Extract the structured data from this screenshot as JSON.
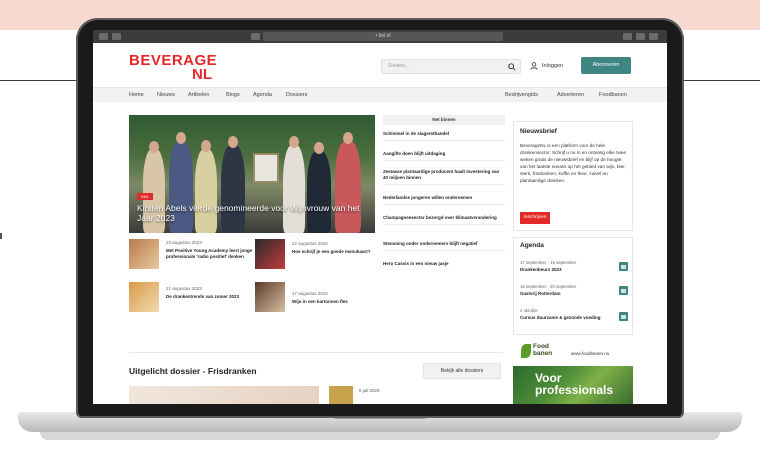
{
  "browser": {
    "url": "• bnl.nl"
  },
  "header": {
    "logo_top": "BEVERAGE",
    "logo_bottom": "NL",
    "search_placeholder": "Zoeken...",
    "login_label": "Inloggen",
    "subscribe_label": "Abonneren"
  },
  "nav": {
    "left": [
      "Home",
      "Nieuws",
      "Artikelen",
      "Blogs",
      "Agenda",
      "Dossiers"
    ],
    "right": [
      "Bedrijvengids",
      "Adverteren",
      "Foodbanen"
    ]
  },
  "hero": {
    "tag": "BNL",
    "title": "Kirsten Abels vierde genomineerde voor Wijnvrouw van het Jaar 2023"
  },
  "latest": {
    "tab_label": "Net binnen",
    "items": [
      "Schimmel in de slagersthandel",
      "Aangifte doen blijft uitdaging",
      "Zeeuwse plantaardige producent haalt investering van 40 miljoen binnen",
      "Nederlandse jongeren willen ondernemen",
      "Champagneesector bezorgd over klimaatverandering",
      "Stemming onder ondernemers blijft negatief",
      "Hero Cassis in een nieuw jasje"
    ]
  },
  "articles": [
    {
      "date": "23 augustus 2023",
      "title": "Met Positive Young Academy leert jonge professionals 'radio positief' denken"
    },
    {
      "date": "22 augustus 2023",
      "title": "Hoe schrijf je een goede menukaart?"
    },
    {
      "date": "21 augustus 2023",
      "title": "De drankentrends van zomer 2023"
    },
    {
      "date": "17 augustus 2023",
      "title": "Wijn in een kartonnen fles"
    }
  ],
  "newsletter": {
    "title": "Nieuwsbrief",
    "text": "BeverageNL is een platform voor de hele drankensector. Schrijf u nu in en ontvang elke twee weken gratis de nieuwsbrief en blijf op de hoogte van het laatste nieuws op het gebied van wijn, bier, sterk, frisdranken, koffie en thee, zuivel en plantaardige dranken.",
    "button": "Inschrijven"
  },
  "agenda": {
    "title": "Agenda",
    "events": [
      {
        "date": "17 september - 19 september",
        "name": "Drankenbeurs 2023"
      },
      {
        "date": "18 september - 20 september",
        "name": "Gastvrij Rotterdam"
      },
      {
        "date": "2 oktober",
        "name": "Cursus duurzame & gezonde voeding"
      }
    ]
  },
  "foodbanen": {
    "logo_top": "Food",
    "logo_bottom": "banen",
    "url": "www.foodbanen.nu",
    "ad_text": "Voor professionals"
  },
  "dossier": {
    "title": "Uitgelicht dossier - Frisdranken",
    "button": "Bekijk alle dossiers",
    "date": "6 juli 2023"
  },
  "colors": {
    "brand_red": "#e32a2a",
    "accent_teal": "#3f8583"
  }
}
